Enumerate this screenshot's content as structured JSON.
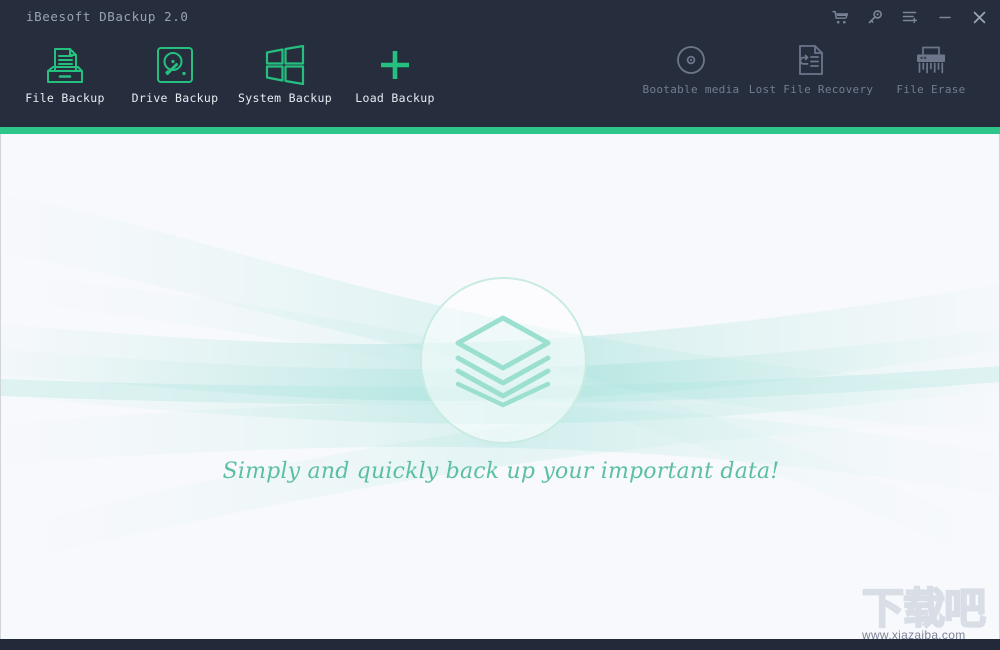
{
  "window": {
    "title": "iBeesoft DBackup 2.0",
    "controls": [
      {
        "name": "cart-icon",
        "label": "Buy now"
      },
      {
        "name": "key-icon",
        "label": "Register"
      },
      {
        "name": "menu-icon",
        "label": "Menu"
      },
      {
        "name": "minimize-icon",
        "label": "Minimize"
      },
      {
        "name": "close-icon",
        "label": "Close"
      }
    ]
  },
  "toolbar": {
    "primary": [
      {
        "label": "File Backup",
        "icon": "document-tray-icon"
      },
      {
        "label": "Drive Backup",
        "icon": "hard-drive-icon"
      },
      {
        "label": "System Backup",
        "icon": "windows-logo-icon"
      },
      {
        "label": "Load Backup",
        "icon": "plus-icon"
      }
    ],
    "secondary": [
      {
        "label": "Bootable media",
        "icon": "disc-icon"
      },
      {
        "label": "Lost File Recovery",
        "icon": "file-restore-icon"
      },
      {
        "label": "File Erase",
        "icon": "shredder-icon"
      }
    ]
  },
  "main": {
    "logo_icon": "layers-stack-icon",
    "tagline": "Simply and quickly back up your important data!"
  },
  "watermark": {
    "text_cn": "下载吧",
    "url": "www.xiazaiba.com"
  },
  "colors": {
    "accent_green": "#2cc68b",
    "header_dark": "#262d3d",
    "stage_background": "#f8f9fc",
    "tagline_teal": "#5bbfa4",
    "dim_label": "#737c91"
  }
}
